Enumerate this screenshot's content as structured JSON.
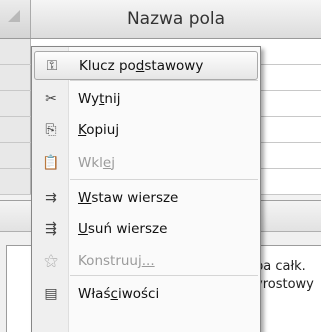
{
  "header": {
    "column_title": "Nazwa pola"
  },
  "properties": {
    "line1": "ba całk.",
    "line2": "yrostowy"
  },
  "context_menu": {
    "items": [
      {
        "pre": "Klucz po",
        "accel": "d",
        "post": "stawowy",
        "icon": "key-icon",
        "glyph": "⚿",
        "state": "hover"
      },
      {
        "pre": "Wy",
        "accel": "t",
        "post": "nij",
        "icon": "scissors-icon",
        "glyph": "✂",
        "state": "enabled"
      },
      {
        "pre": "",
        "accel": "K",
        "post": "opiuj",
        "icon": "copy-icon",
        "glyph": "⎘",
        "state": "enabled"
      },
      {
        "pre": "Wkl",
        "accel": "e",
        "post": "j",
        "icon": "paste-icon",
        "glyph": "📋",
        "state": "disabled"
      },
      {
        "pre": "",
        "accel": "W",
        "post": "staw wiersze",
        "icon": "insert-rows-icon",
        "glyph": "⇉",
        "state": "enabled"
      },
      {
        "pre": "",
        "accel": "U",
        "post": "suń wiersze",
        "icon": "delete-rows-icon",
        "glyph": "⇶",
        "state": "enabled"
      },
      {
        "pre": "Konstruuj",
        "accel": "...",
        "post": "",
        "icon": "builder-wand-icon",
        "glyph": "⚝",
        "state": "disabled"
      },
      {
        "pre": "Właś",
        "accel": "c",
        "post": "iwości",
        "icon": "properties-icon",
        "glyph": "▤",
        "state": "enabled"
      }
    ]
  }
}
